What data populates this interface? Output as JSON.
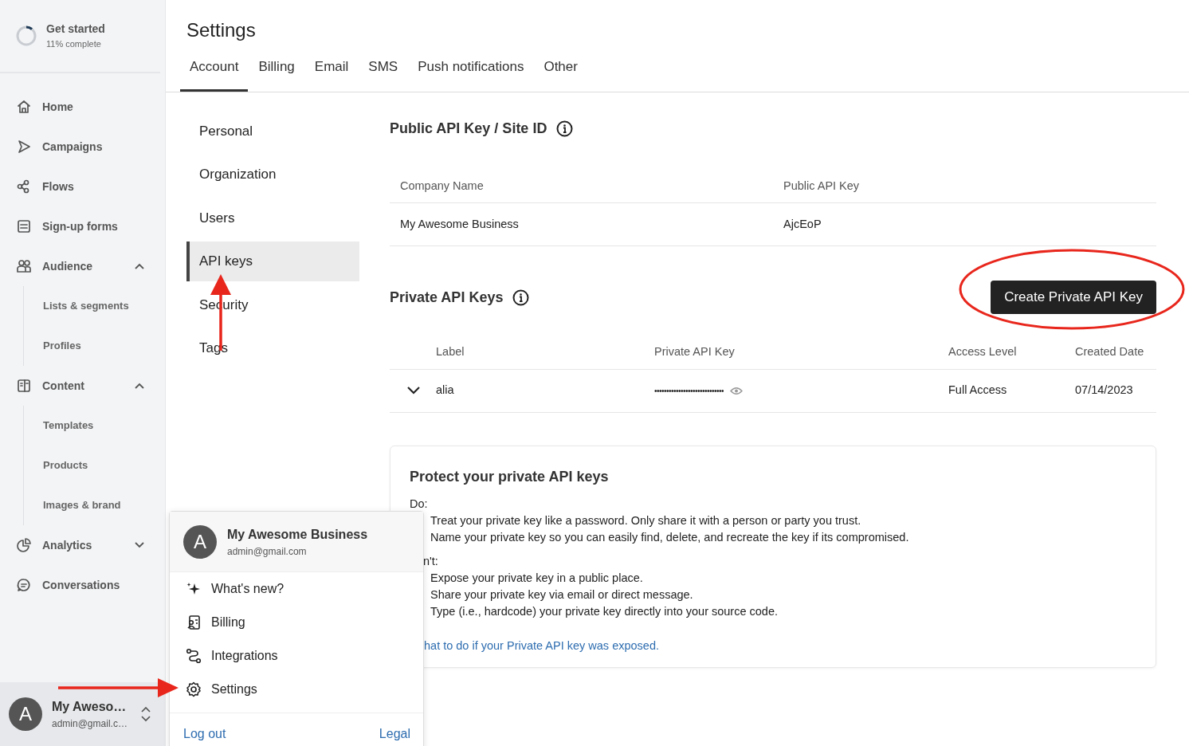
{
  "sidebar": {
    "progress": {
      "title": "Get started",
      "subtitle": "11% complete",
      "level": 0.11
    },
    "items": [
      {
        "label": "Home"
      },
      {
        "label": "Campaigns"
      },
      {
        "label": "Flows"
      },
      {
        "label": "Sign-up forms"
      },
      {
        "label": "Audience",
        "expanded": true,
        "children": [
          {
            "label": "Lists & segments"
          },
          {
            "label": "Profiles"
          }
        ]
      },
      {
        "label": "Content",
        "expanded": true,
        "children": [
          {
            "label": "Templates"
          },
          {
            "label": "Products"
          },
          {
            "label": "Images & brand"
          }
        ]
      },
      {
        "label": "Analytics",
        "expanded": false
      },
      {
        "label": "Conversations"
      }
    ],
    "account": {
      "initial": "A",
      "name": "My Aweso…",
      "email": "admin@gmail.c…"
    }
  },
  "header": {
    "title": "Settings"
  },
  "tabs": [
    {
      "label": "Account",
      "selected": true
    },
    {
      "label": "Billing",
      "selected": false
    },
    {
      "label": "Email",
      "selected": false
    },
    {
      "label": "SMS",
      "selected": false
    },
    {
      "label": "Push notifications",
      "selected": false
    },
    {
      "label": "Other",
      "selected": false
    }
  ],
  "subnav": [
    {
      "label": "Personal",
      "selected": false
    },
    {
      "label": "Organization",
      "selected": false
    },
    {
      "label": "Users",
      "selected": false
    },
    {
      "label": "API keys",
      "selected": true
    },
    {
      "label": "Security",
      "selected": false
    },
    {
      "label": "Tags",
      "selected": false
    }
  ],
  "public_api": {
    "title": "Public API Key / Site ID",
    "columns": [
      "Company Name",
      "Public API Key"
    ],
    "rows": [
      [
        "My Awesome Business",
        "AjcEoP"
      ]
    ]
  },
  "private_api": {
    "title": "Private API Keys",
    "button": "Create Private API Key",
    "columns": [
      "Label",
      "Private API Key",
      "Access Level",
      "Created Date"
    ],
    "rows": [
      {
        "expanded": false,
        "label": "alia",
        "key": "•••••••••••••••••••••••••••••",
        "access": "Full Access",
        "date": "07/14/2023"
      }
    ]
  },
  "notice": {
    "title": "Protect your private API keys",
    "do_heading": "Do:",
    "do_items": [
      "Treat your private key like a password. Only share it with a person or party you trust.",
      "Name your private key so you can easily find, delete, and recreate the key if its compromised."
    ],
    "dont_heading": "n't:",
    "dont_items": [
      "Expose your private key in a public place.",
      "Share your private key via email or direct message.",
      "Type (i.e., hardcode) your private key directly into your source code."
    ],
    "link": "hat to do if your Private API key was exposed."
  },
  "account_menu": {
    "initial": "A",
    "name": "My Awesome Business",
    "email": "admin@gmail.com",
    "items": [
      {
        "label": "What's new?"
      },
      {
        "label": "Billing"
      },
      {
        "label": "Integrations"
      },
      {
        "label": "Settings"
      }
    ],
    "footer_links": [
      "Log out",
      "Legal"
    ]
  }
}
